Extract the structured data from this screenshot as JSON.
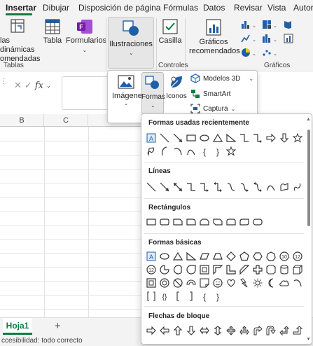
{
  "tabs": [
    "Insertar",
    "Dibujar",
    "Disposición de página",
    "Fórmulas",
    "Datos",
    "Revisar",
    "Vista",
    "Autor"
  ],
  "ribbon": {
    "pivot_label_line1": "las dinámicas",
    "pivot_label_line2": "omendadas",
    "tabla": "Tabla",
    "formularios": "Formularios",
    "ilustraciones": "Ilustraciones",
    "casilla": "Casilla",
    "graficos_line1": "Gráficos",
    "graficos_line2": "recomendados",
    "group_tablas": "Tablas",
    "group_controles": "Controles",
    "group_graficos": "Gráficos",
    "fx": "fx"
  },
  "ilustraciones_menu": {
    "imagenes": "Imágenes",
    "formas": "Formas",
    "iconos": "Iconos",
    "modelos3d": "Modelos 3D",
    "smartart": "SmartArt",
    "captura": "Captura"
  },
  "grid": {
    "columns": [
      "B",
      "C"
    ]
  },
  "shapes_panel": {
    "sections": [
      "Formas usadas recientemente",
      "Líneas",
      "Rectángulos",
      "Formas básicas",
      "Flechas de bloque"
    ]
  },
  "sheets": {
    "active": "Hoja1",
    "add": "+"
  },
  "status": "ccesibilidad: todo correcto",
  "colors": {
    "accent": "#107c41",
    "icon_blue": "#1f5fa8",
    "forms_purple": "#7719aa"
  }
}
